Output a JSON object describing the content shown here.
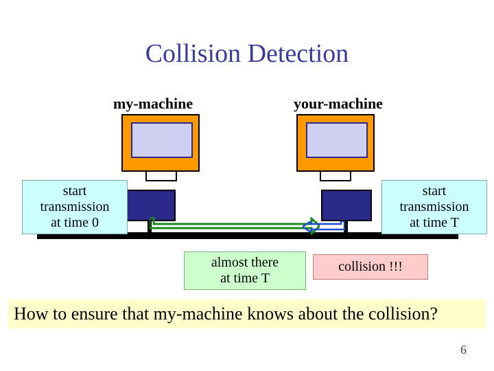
{
  "title": "Collision Detection",
  "labels": {
    "my": "my-machine",
    "your": "your-machine"
  },
  "callouts": {
    "start_left_l1": "start",
    "start_left_l2": "transmission",
    "start_left_l3": "at time 0",
    "start_right_l1": "start",
    "start_right_l2": "transmission",
    "start_right_l3": "at time T",
    "almost_l1": "almost there",
    "almost_l2": "at time T",
    "collision": "collision !!!"
  },
  "question": "How to ensure that my-machine knows about the collision?",
  "page": "6"
}
